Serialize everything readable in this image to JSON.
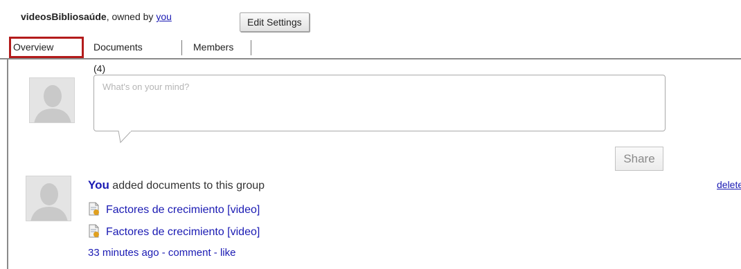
{
  "header": {
    "group_name": "videosBibliosaúde",
    "owned_by_text": ", owned by ",
    "owner_link": "you",
    "edit_settings_label": "Edit Settings"
  },
  "tabs": [
    {
      "label": "Overview",
      "active": true
    },
    {
      "label": "Documents (4)",
      "active": false
    },
    {
      "label": "Members",
      "active": false
    }
  ],
  "composer": {
    "placeholder": "What's on your mind?",
    "share_label": "Share"
  },
  "activity": {
    "actor": "You",
    "action_text": " added documents to this group",
    "delete_label": "delete",
    "documents": [
      {
        "title": "Factores de crecimiento [video]",
        "icon": "document-icon"
      },
      {
        "title": "Factores de crecimiento [video]",
        "icon": "document-icon"
      }
    ],
    "meta": {
      "time": "33 minutes ago",
      "sep": " - ",
      "comment_label": "comment",
      "like_label": "like"
    }
  },
  "colors": {
    "link": "#1a1ab3",
    "highlight_border": "#b31b1b"
  }
}
